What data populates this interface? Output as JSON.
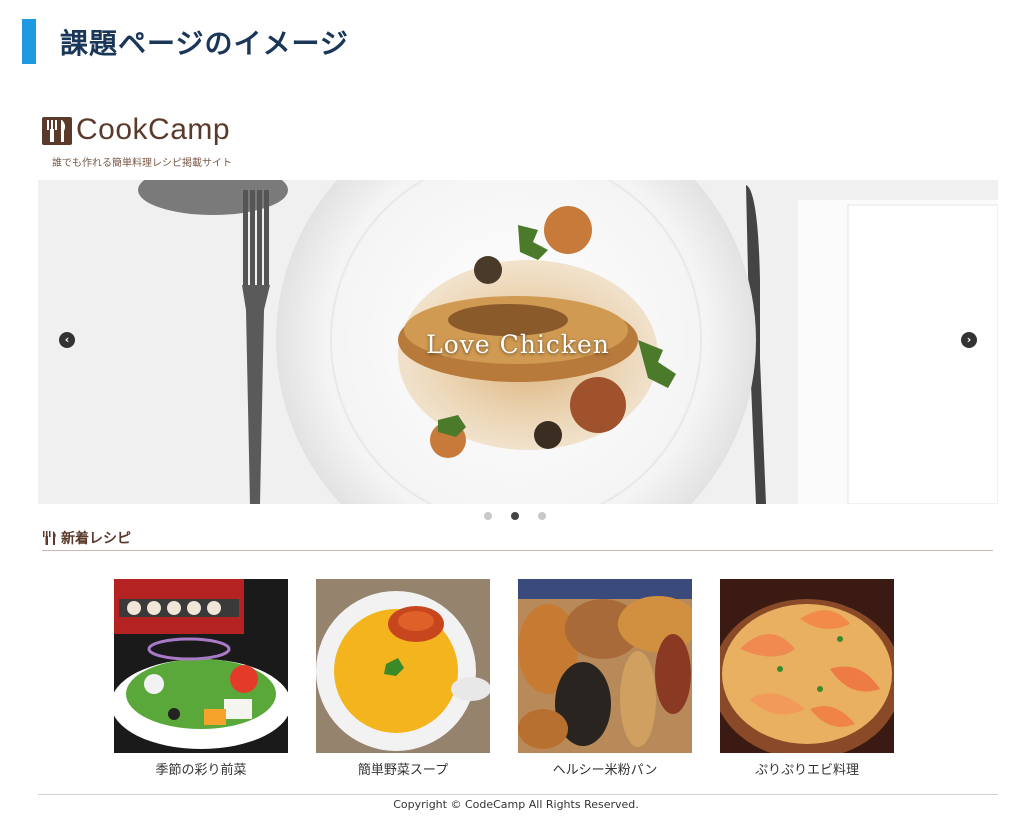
{
  "page": {
    "heading": "課題ページのイメージ",
    "accent_color": "#1e9be0",
    "heading_color": "#1a3658"
  },
  "site": {
    "logo_text": "CookCamp",
    "tagline": "誰でも作れる簡単料理レシピ掲載サイト",
    "brand_color": "#5b3a2c"
  },
  "carousel": {
    "caption": "Love Chicken",
    "prev_icon": "‹",
    "next_icon": "›",
    "slide_count": 3,
    "active_slide": 2
  },
  "section": {
    "title": "新着レシピ",
    "icon": "fork-knife-icon"
  },
  "recipes": [
    {
      "name": "季節の彩り前菜"
    },
    {
      "name": "簡単野菜スープ"
    },
    {
      "name": "ヘルシー米粉パン"
    },
    {
      "name": "ぷりぷりエビ料理"
    }
  ],
  "footer": {
    "copyright": "Copyright © CodeCamp All Rights Reserved."
  }
}
